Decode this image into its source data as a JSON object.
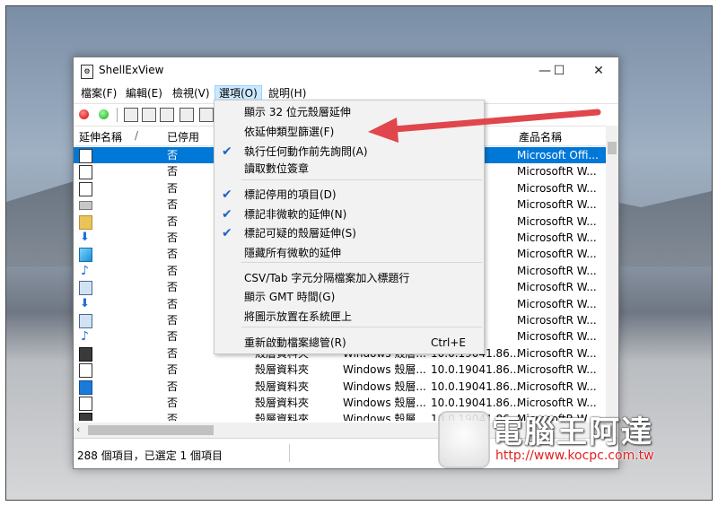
{
  "window": {
    "title": "ShellExView",
    "minimize": "—",
    "maximize": "☐",
    "close": "✕"
  },
  "menubar": [
    {
      "label": "檔案(F)"
    },
    {
      "label": "編輯(E)"
    },
    {
      "label": "檢視(V)"
    },
    {
      "label": "選項(O)"
    },
    {
      "label": "說明(H)"
    }
  ],
  "columns": {
    "name": "延伸名稱",
    "sort": "/",
    "disabled": "已停用",
    "product": "產品名稱"
  },
  "rows": [
    {
      "disabled": "否",
      "type": "",
      "desc": "",
      "version": ".10",
      "product": "Microsoft Offi...",
      "icon": "doc-icon",
      "selected": true
    },
    {
      "disabled": "否",
      "type": "",
      "desc": "",
      "version": ".86...",
      "product": "MicrosoftR W...",
      "icon": "doc-icon"
    },
    {
      "disabled": "否",
      "type": "",
      "desc": "",
      "version": ".86...",
      "product": "MicrosoftR W...",
      "icon": "doc-icon"
    },
    {
      "disabled": "否",
      "type": "",
      "desc": "",
      "version": ".86...",
      "product": "MicrosoftR W...",
      "icon": "drive-icon"
    },
    {
      "disabled": "否",
      "type": "",
      "desc": "",
      "version": ".86...",
      "product": "MicrosoftR W...",
      "icon": "folder-icon"
    },
    {
      "disabled": "否",
      "type": "",
      "desc": "",
      "version": ".86...",
      "product": "MicrosoftR W...",
      "icon": "download-arrow-icon"
    },
    {
      "disabled": "否",
      "type": "",
      "desc": "",
      "version": ".86...",
      "product": "MicrosoftR W...",
      "icon": "cube-icon"
    },
    {
      "disabled": "否",
      "type": "",
      "desc": "",
      "version": ".86...",
      "product": "MicrosoftR W...",
      "icon": "music-note-icon"
    },
    {
      "disabled": "否",
      "type": "",
      "desc": "",
      "version": ".86...",
      "product": "MicrosoftR W...",
      "icon": "screen-icon"
    },
    {
      "disabled": "否",
      "type": "",
      "desc": "",
      "version": ".86...",
      "product": "MicrosoftR W...",
      "icon": "download-arrow-icon"
    },
    {
      "disabled": "否",
      "type": "",
      "desc": "",
      "version": ".86...",
      "product": "MicrosoftR W...",
      "icon": "screen-icon"
    },
    {
      "disabled": "否",
      "type": "",
      "desc": "",
      "version": ".86...",
      "product": "MicrosoftR W...",
      "icon": "music-note-icon"
    },
    {
      "disabled": "否",
      "type": "殼層資料夾",
      "desc": "Windows 殼層...",
      "version": "10.0.19041.86...",
      "product": "MicrosoftR W...",
      "icon": "film-icon"
    },
    {
      "disabled": "否",
      "type": "殼層資料夾",
      "desc": "Windows 殼層...",
      "version": "10.0.19041.86...",
      "product": "MicrosoftR W...",
      "icon": "doc-icon"
    },
    {
      "disabled": "否",
      "type": "殼層資料夾",
      "desc": "Windows 殼層...",
      "version": "10.0.19041.86...",
      "product": "MicrosoftR W...",
      "icon": "blue-folder-icon"
    },
    {
      "disabled": "否",
      "type": "殼層資料夾",
      "desc": "Windows 殼層...",
      "version": "10.0.19041.86...",
      "product": "MicrosoftR W...",
      "icon": "doc-icon"
    },
    {
      "disabled": "否",
      "type": "殼層資料夾",
      "desc": "Windows 殼層...",
      "version": "10.0.19041.86...",
      "product": "MicrosoftR W...",
      "icon": "film-icon"
    }
  ],
  "status": {
    "text": "288 個項目，已選定 1 個項目"
  },
  "options_menu": [
    {
      "label": "顯示 32 位元殼層延伸",
      "checked": false,
      "shortcut": ""
    },
    {
      "label": "依延伸類型篩選(F)",
      "checked": false,
      "shortcut": ""
    },
    {
      "label": "執行任何動作前先詢問(A)",
      "checked": true,
      "shortcut": ""
    },
    {
      "label": "讀取數位簽章",
      "checked": false,
      "shortcut": ""
    },
    {
      "label": "標記停用的項目(D)",
      "checked": true,
      "shortcut": ""
    },
    {
      "label": "標記非微軟的延伸(N)",
      "checked": true,
      "shortcut": ""
    },
    {
      "label": "標記可疑的殼層延伸(S)",
      "checked": true,
      "shortcut": ""
    },
    {
      "label": "隱藏所有微軟的延伸",
      "checked": false,
      "shortcut": ""
    },
    {
      "label": "CSV/Tab 字元分隔檔案加入標題行",
      "checked": false,
      "shortcut": ""
    },
    {
      "label": "顯示 GMT 時間(G)",
      "checked": false,
      "shortcut": ""
    },
    {
      "label": "將圖示放置在系統匣上",
      "checked": false,
      "shortcut": ""
    },
    {
      "label": "重新啟動檔案總管(R)",
      "checked": false,
      "shortcut": "Ctrl+E"
    }
  ],
  "checkmark": "✔",
  "watermark": {
    "title": "電腦王阿達",
    "url": "http://www.kocpc.com.tw"
  },
  "colors": {
    "selection": "#0078d7",
    "arrow": "#e0464b",
    "check": "#1e63c7"
  }
}
